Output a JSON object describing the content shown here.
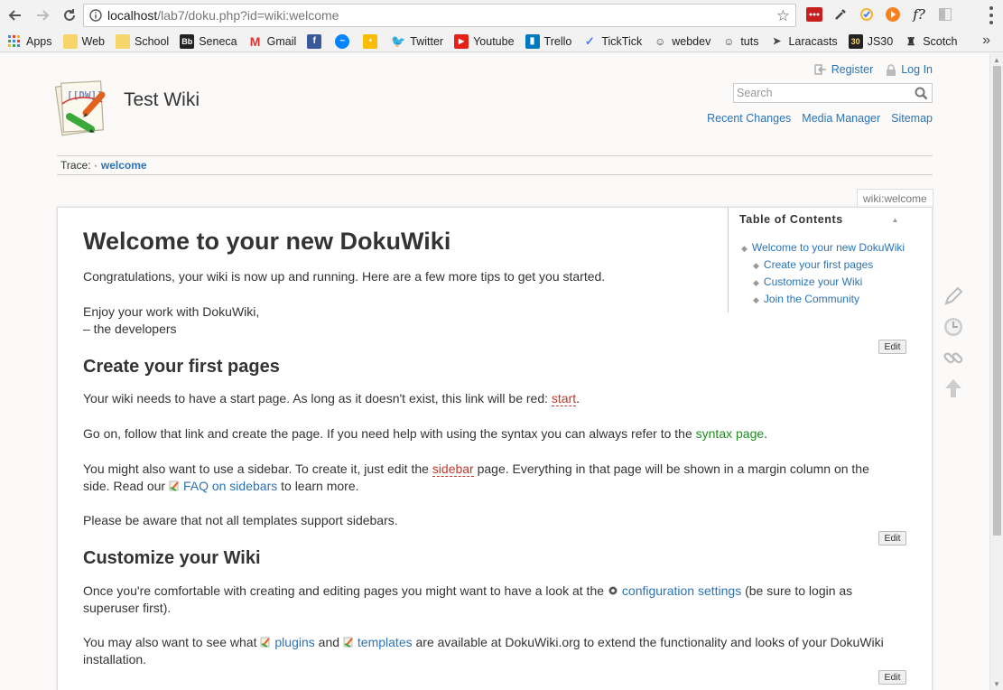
{
  "browser": {
    "url_prefix": "localhost",
    "url_rest": "/lab7/doku.php?id=wiki:welcome",
    "bookmarks": [
      "Apps",
      "Web",
      "School",
      "Seneca",
      "Gmail",
      "",
      "",
      "",
      "Twitter",
      "Youtube",
      "Trello",
      "TickTick",
      "webdev",
      "tuts",
      "Laracasts",
      "JS30",
      "Scotch"
    ],
    "more": "»"
  },
  "wiki": {
    "title": "Test Wiki",
    "user_tools": {
      "register": "Register",
      "login": "Log In"
    },
    "search_placeholder": "Search",
    "site_tools": {
      "recent": "Recent Changes",
      "media": "Media Manager",
      "sitemap": "Sitemap"
    },
    "trace": {
      "label": "Trace:",
      "sep": "·",
      "current": "welcome"
    },
    "page_id": "wiki:welcome",
    "toc": {
      "title": "Table of Contents",
      "items": [
        "Welcome to your new DokuWiki",
        "Create your first pages",
        "Customize your Wiki",
        "Join the Community"
      ]
    },
    "article": {
      "h1": "Welcome to your new DokuWiki",
      "intro": "Congratulations, your wiki is now up and running. Here are a few more tips to get you started.",
      "enjoy": "Enjoy your work with DokuWiki,",
      "devs": "– the developers",
      "h2_create": "Create your first pages",
      "start_pre": "Your wiki needs to have a start page. As long as it doesn't exist, this link will be red: ",
      "start_link": "start",
      "start_post": ".",
      "goon_pre": "Go on, follow that link and create the page. If you need help with using the syntax you can always refer to the ",
      "goon_link": "syntax page",
      "goon_post": ".",
      "sidebar_pre": "You might also want to use a sidebar. To create it, just edit the ",
      "sidebar_link": "sidebar",
      "sidebar_mid": " page. Everything in that page will be shown in a margin column on the side. Read our ",
      "faq_link": "FAQ on sidebars",
      "sidebar_post": " to learn more.",
      "aware": "Please be aware that not all templates support sidebars.",
      "h2_customize": "Customize your Wiki",
      "config_pre": "Once you're comfortable with creating and editing pages you might want to have a look at the ",
      "config_link": "configuration settings",
      "config_post": " (be sure to login as superuser first).",
      "plug_pre": "You may also want to see what ",
      "plug_link": "plugins",
      "plug_mid": " and ",
      "tmpl_link": "templates",
      "plug_post": " are available at DokuWiki.org to extend the functionality and looks of your DokuWiki installation.",
      "edit": "Edit"
    }
  }
}
